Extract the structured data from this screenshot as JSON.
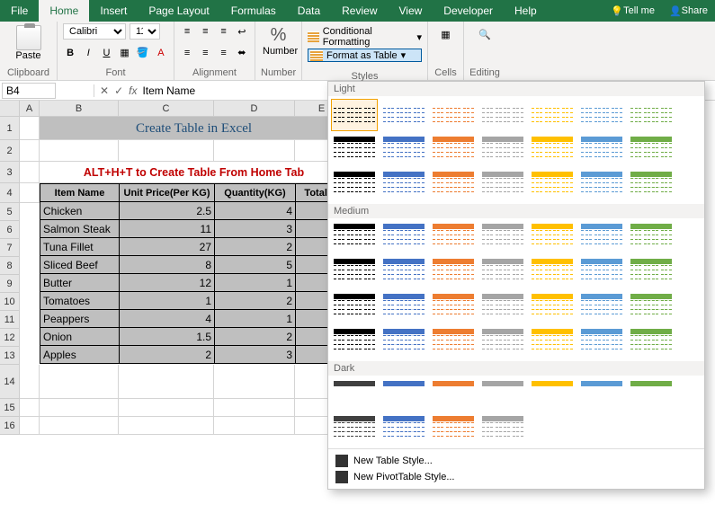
{
  "tabs": {
    "file": "File",
    "home": "Home",
    "insert": "Insert",
    "pagelayout": "Page Layout",
    "formulas": "Formulas",
    "data": "Data",
    "review": "Review",
    "view": "View",
    "developer": "Developer",
    "help": "Help",
    "tellme": "Tell me",
    "share": "Share"
  },
  "ribbon": {
    "clipboard": {
      "paste": "Paste",
      "label": "Clipboard"
    },
    "font": {
      "name": "Calibri",
      "size": "11",
      "label": "Font",
      "bold": "B",
      "italic": "I",
      "underline": "U"
    },
    "alignment": {
      "label": "Alignment"
    },
    "number": {
      "label": "Number",
      "text": "Number"
    },
    "styles": {
      "conditional": "Conditional Formatting",
      "formatTable": "Format as Table",
      "label": "Styles"
    },
    "cells": {
      "label": "Cells"
    },
    "editing": {
      "label": "Editing"
    }
  },
  "namebox": {
    "ref": "B4",
    "formula": "Item Name"
  },
  "colHeaders": [
    "A",
    "B",
    "C",
    "D",
    "E"
  ],
  "rowHeaders": [
    "1",
    "2",
    "3",
    "4",
    "5",
    "6",
    "7",
    "8",
    "9",
    "10",
    "11",
    "12",
    "13",
    "14",
    "15",
    "16"
  ],
  "sheet": {
    "title": "Create Table in Excel",
    "subtitle": "ALT+H+T to Create Table From Home Tab",
    "headers": [
      "Item Name",
      "Unit Price(Per KG)",
      "Quantity(KG)",
      "Total Pr"
    ],
    "rows": [
      {
        "name": "Chicken",
        "price": "2.5",
        "qty": "4"
      },
      {
        "name": "Salmon Steak",
        "price": "11",
        "qty": "3"
      },
      {
        "name": "Tuna Fillet",
        "price": "27",
        "qty": "2"
      },
      {
        "name": "Sliced Beef",
        "price": "8",
        "qty": "5"
      },
      {
        "name": "Butter",
        "price": "12",
        "qty": "1"
      },
      {
        "name": "Tomatoes",
        "price": "1",
        "qty": "2"
      },
      {
        "name": "Peappers",
        "price": "4",
        "qty": "1"
      },
      {
        "name": "Onion",
        "price": "1.5",
        "qty": "2"
      },
      {
        "name": "Apples",
        "price": "2",
        "qty": "3"
      }
    ]
  },
  "gallery": {
    "sections": [
      "Light",
      "Medium",
      "Dark"
    ],
    "light_colors": [
      "#000",
      "#4472c4",
      "#ed7d31",
      "#a5a5a5",
      "#ffc000",
      "#5b9bd5",
      "#70ad47"
    ],
    "medium_colors": [
      "#000",
      "#4472c4",
      "#ed7d31",
      "#a5a5a5",
      "#ffc000",
      "#5b9bd5",
      "#70ad47"
    ],
    "dark_colors": [
      "#404040",
      "#4472c4",
      "#ed7d31",
      "#a5a5a5",
      "#ffc000",
      "#5b9bd5",
      "#70ad47"
    ],
    "newTable": "New Table Style...",
    "newPivot": "New PivotTable Style..."
  },
  "colWidths": {
    "A": 22,
    "B": 88,
    "C": 106,
    "D": 90,
    "E": 60
  }
}
